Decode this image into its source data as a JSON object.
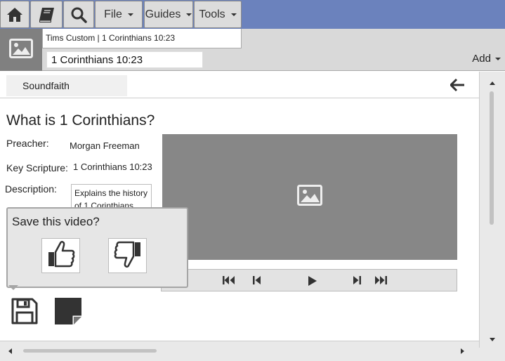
{
  "toolbar": {
    "home_icon": "home-icon",
    "library_icon": "book-icon",
    "search_icon": "search-icon",
    "file_label": "File",
    "guides_label": "Guides",
    "tools_label": "Tools",
    "accent_color": "#6b82bd"
  },
  "document": {
    "tab_title": "Tims Custom | 1 Corinthians 10:23",
    "reference": "1 Corinthians  10:23",
    "add_label": "Add"
  },
  "content": {
    "source_tab": "Soundfaith",
    "title": "What is 1 Corinthians?",
    "preacher_label": "Preacher:",
    "preacher_value": "Morgan Freeman",
    "scripture_label": "Key Scripture:",
    "scripture_value": "1 Corinthians 10:23",
    "description_label": "Description:",
    "description_value": "Explains the history of 1 Corinthians"
  },
  "popup": {
    "title": "Save this video?"
  }
}
